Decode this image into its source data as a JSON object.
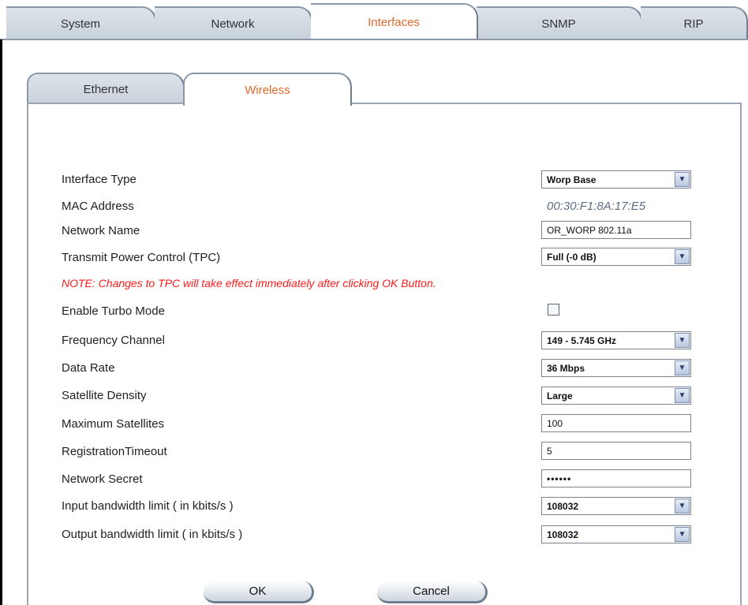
{
  "top_tabs": [
    {
      "label": "System",
      "active": false
    },
    {
      "label": "Network",
      "active": false
    },
    {
      "label": "Interfaces",
      "active": true
    },
    {
      "label": "SNMP",
      "active": false
    },
    {
      "label": "RIP",
      "active": false
    }
  ],
  "sub_tabs": [
    {
      "label": "Ethernet",
      "active": false
    },
    {
      "label": "Wireless",
      "active": true
    }
  ],
  "form": {
    "interface_type": {
      "label": "Interface Type",
      "value": "Worp Base"
    },
    "mac_address": {
      "label": "MAC Address",
      "value": "00:30:F1:8A:17:E5"
    },
    "network_name": {
      "label": "Network Name",
      "value": "OR_WORP 802.11a"
    },
    "tpc": {
      "label": "Transmit Power Control (TPC)",
      "value": "Full (-0 dB)"
    },
    "note": "NOTE: Changes to TPC will take effect immediately after clicking OK Button.",
    "turbo": {
      "label": "Enable Turbo Mode",
      "checked": false
    },
    "frequency": {
      "label": "Frequency Channel",
      "value": "149 - 5.745 GHz"
    },
    "data_rate": {
      "label": "Data Rate",
      "value": "36 Mbps"
    },
    "satellite_density": {
      "label": "Satellite Density",
      "value": "Large"
    },
    "max_satellites": {
      "label": "Maximum Satellites",
      "value": "100"
    },
    "registration_timeout": {
      "label": "RegistrationTimeout",
      "value": "5"
    },
    "network_secret": {
      "label": "Network Secret",
      "value": "••••••"
    },
    "input_bw": {
      "label": "Input bandwidth limit ( in kbits/s )",
      "value": "108032"
    },
    "output_bw": {
      "label": "Output bandwidth limit ( in kbits/s )",
      "value": "108032"
    }
  },
  "buttons": {
    "ok": "OK",
    "cancel": "Cancel"
  },
  "colors": {
    "active_tab_text": "#e06a2b",
    "note_text": "#ff1a1a",
    "mac_text": "#5b6d86"
  }
}
